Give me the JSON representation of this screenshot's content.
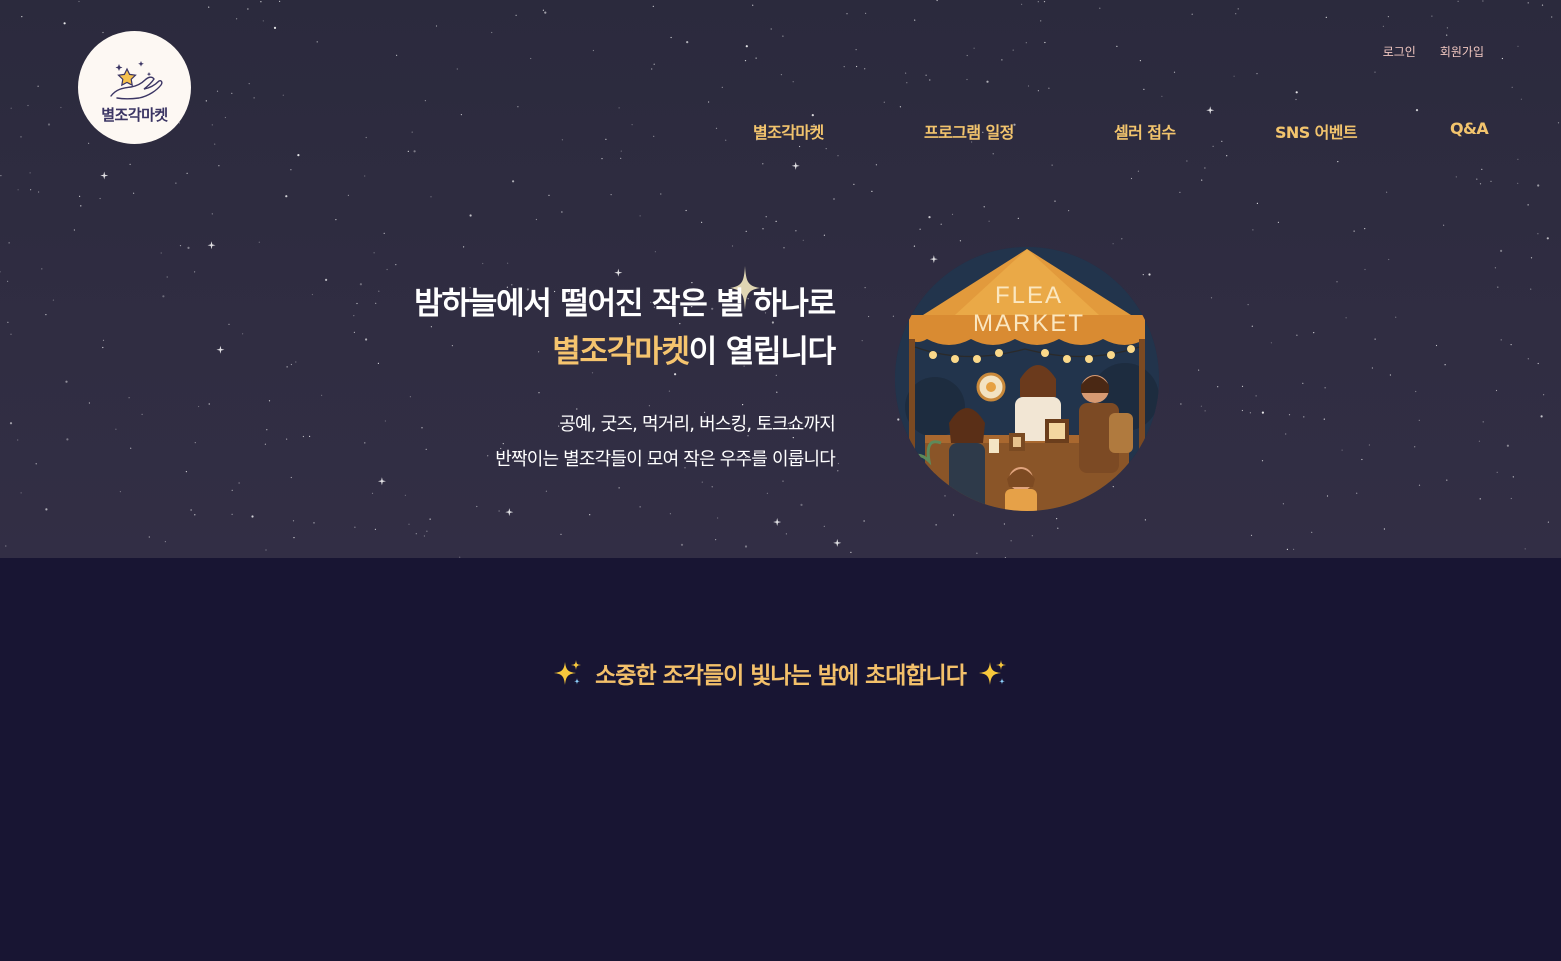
{
  "logo": {
    "text": "별조각마켓",
    "icon": "star-in-hand-icon"
  },
  "util_nav": {
    "login": "로그인",
    "signup": "회원가입"
  },
  "main_nav": [
    {
      "label": "별조각마켓"
    },
    {
      "label": "프로그램 일정"
    },
    {
      "label": "셀러 접수"
    },
    {
      "label": "SNS 어벤트"
    },
    {
      "label": "Q&A"
    }
  ],
  "hero": {
    "headline_line1": "밤하늘에서 떨어진 작은 별 하나로",
    "headline_accent": "별조각마켓",
    "headline_line2_rest": "이 열립니다",
    "desc_line1": "공예, 굿즈, 먹거리, 버스킹, 토크쇼까지",
    "desc_line2": "반짝이는 별조각들이 모여 작은 우주를 이룹니다",
    "illustration": {
      "sign_line1": "FLEA",
      "sign_line2": "MARKET"
    }
  },
  "invite": {
    "text": "소중한 조각들이 빛나는 밤에 초대합니다",
    "left_icon": "sparkles-icon",
    "right_icon": "sparkles-icon"
  },
  "colors": {
    "hero_bg": "#2d2b3f",
    "section_bg": "#181533",
    "accent": "#f5c46e",
    "util_link": "#f0c6c0"
  }
}
